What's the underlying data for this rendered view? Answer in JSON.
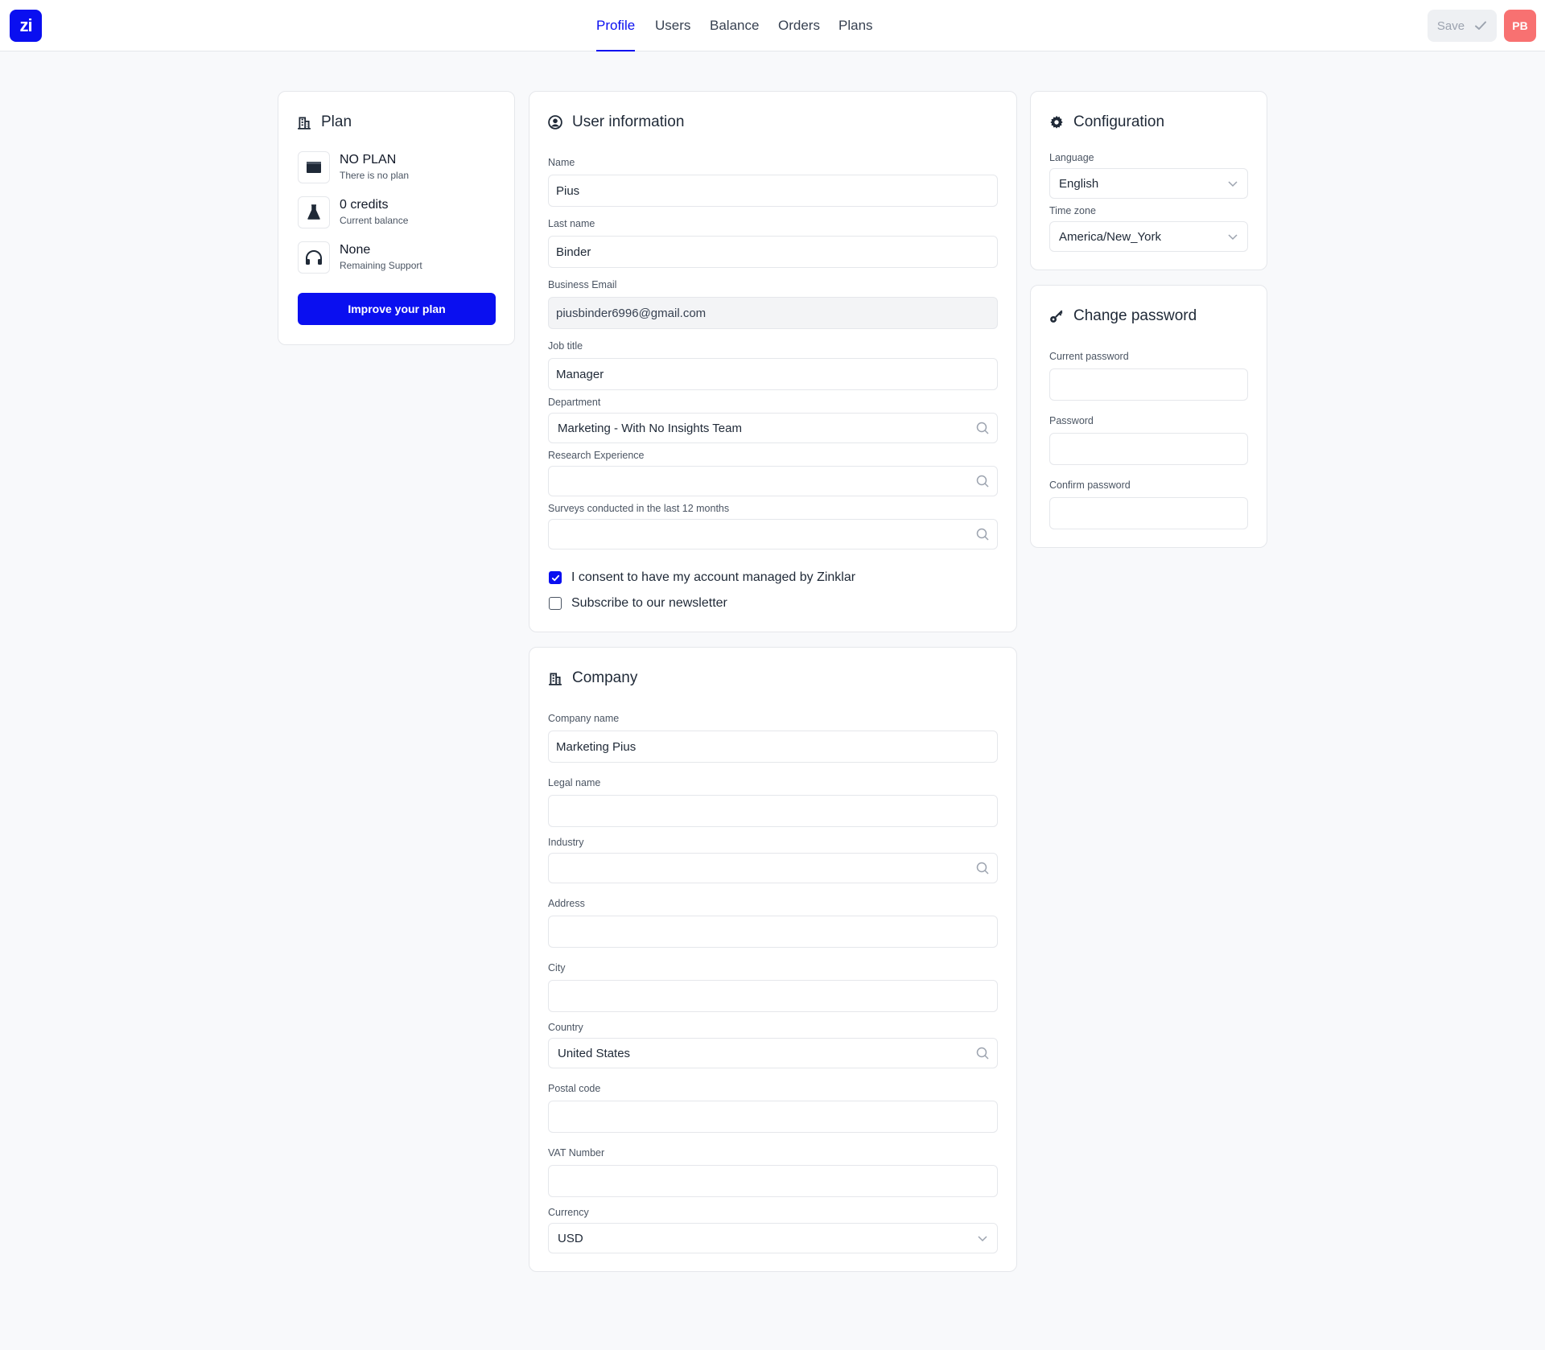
{
  "brand": {
    "logo_text": "zi"
  },
  "nav": {
    "items": [
      {
        "label": "Profile"
      },
      {
        "label": "Users"
      },
      {
        "label": "Balance"
      },
      {
        "label": "Orders"
      },
      {
        "label": "Plans"
      }
    ],
    "active": "Profile"
  },
  "header": {
    "save_label": "Save",
    "avatar_initials": "PB"
  },
  "plan": {
    "title": "Plan",
    "items": [
      {
        "title": "NO PLAN",
        "subtitle": "There is no plan",
        "icon": "card-icon"
      },
      {
        "title": "0 credits",
        "subtitle": "Current balance",
        "icon": "flask-icon"
      },
      {
        "title": "None",
        "subtitle": "Remaining Support",
        "icon": "headphones-icon"
      }
    ],
    "button_label": "Improve your plan"
  },
  "user_info": {
    "title": "User information",
    "name_label": "Name",
    "name_value": "Pius",
    "last_name_label": "Last name",
    "last_name_value": "Binder",
    "email_label": "Business Email",
    "email_value": "piusbinder6996@gmail.com",
    "job_label": "Job title",
    "job_value": "Manager",
    "department_label": "Department",
    "department_value": "Marketing - With No Insights Team",
    "research_label": "Research Experience",
    "research_value": "",
    "surveys_label": "Surveys conducted in the last 12 months",
    "surveys_value": "",
    "consent_label": "I consent to have my account managed by Zinklar",
    "consent_checked": true,
    "newsletter_label": "Subscribe to our newsletter",
    "newsletter_checked": false
  },
  "company": {
    "title": "Company",
    "company_name_label": "Company name",
    "company_name_value": "Marketing Pius",
    "legal_name_label": "Legal name",
    "legal_name_value": "",
    "industry_label": "Industry",
    "industry_value": "",
    "address_label": "Address",
    "address_value": "",
    "city_label": "City",
    "city_value": "",
    "country_label": "Country",
    "country_value": "United States",
    "postal_label": "Postal code",
    "postal_value": "",
    "vat_label": "VAT Number",
    "vat_value": "",
    "currency_label": "Currency",
    "currency_value": "USD"
  },
  "configuration": {
    "title": "Configuration",
    "language_label": "Language",
    "language_value": "English",
    "timezone_label": "Time zone",
    "timezone_value": "America/New_York"
  },
  "password": {
    "title": "Change password",
    "current_label": "Current password",
    "password_label": "Password",
    "confirm_label": "Confirm password"
  },
  "colors": {
    "accent": "#0a0ff0",
    "avatar": "#f87171"
  }
}
